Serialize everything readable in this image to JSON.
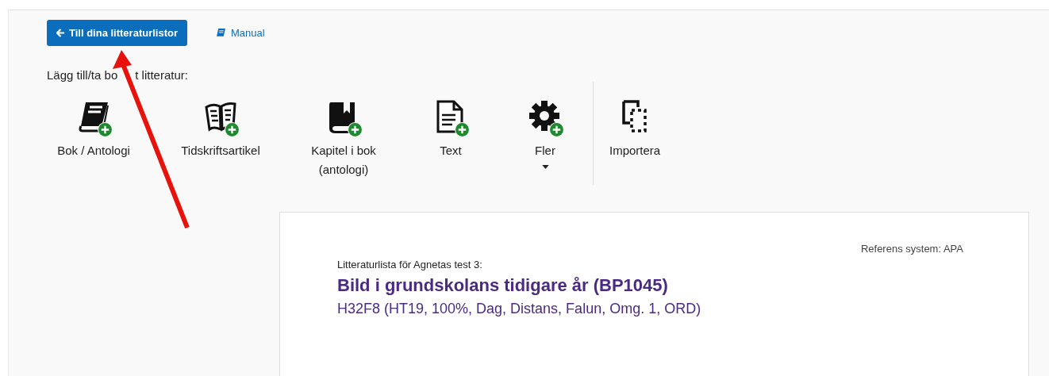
{
  "back_button": {
    "label": "Till dina litteraturlistor"
  },
  "manual_link": {
    "label": "Manual"
  },
  "toolbar": {
    "label_parts": [
      "Lägg till/ta bo",
      "t litteratur:"
    ],
    "items": [
      {
        "label": "Bok / Antologi",
        "add_badge": true,
        "dropdown": false,
        "separated": false
      },
      {
        "label": "Tidskriftsartikel",
        "add_badge": true,
        "dropdown": false,
        "separated": false
      },
      {
        "label": "Kapitel i bok (antologi)",
        "add_badge": true,
        "dropdown": false,
        "separated": false
      },
      {
        "label": "Text",
        "add_badge": true,
        "dropdown": false,
        "separated": false
      },
      {
        "label": "Fler",
        "add_badge": true,
        "dropdown": true,
        "separated": false
      },
      {
        "label": "Importera",
        "add_badge": false,
        "dropdown": false,
        "separated": true
      }
    ]
  },
  "list_card": {
    "reference_system": "Referens system: APA",
    "caption": "Litteraturlista för Agnetas test 3:",
    "title": "Bild i grundskolans tidigare år (BP1045)",
    "subtitle": "H32F8 (HT19, 100%, Dag, Distans, Falun, Omg. 1, ORD)"
  },
  "annotation": {
    "kind": "arrow"
  }
}
